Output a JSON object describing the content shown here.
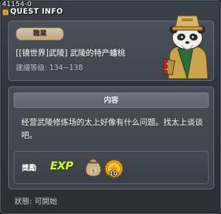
{
  "window": {
    "id": "41154-0",
    "title": "QUEST INFO"
  },
  "quest": {
    "category": "職業",
    "name": "[[镜世界]武陵] 武陵的特产蟠桃",
    "recommended_level": "建議等级: 134~138"
  },
  "content": {
    "header": "内容",
    "text": "经营武陵修炼场的太上好像有什么问题。找太上谈谈吧。"
  },
  "rewards": {
    "label": "獎勵",
    "exp_text": "EXP",
    "items": [
      {
        "icon": "money-bag-icon"
      },
      {
        "icon": "gold-coin-icon",
        "quantity": "10"
      }
    ]
  },
  "status": "狀態:  可開始",
  "colors": {
    "badge": "#c9b394",
    "exp": "#d7f03b",
    "panel": "#444952"
  }
}
